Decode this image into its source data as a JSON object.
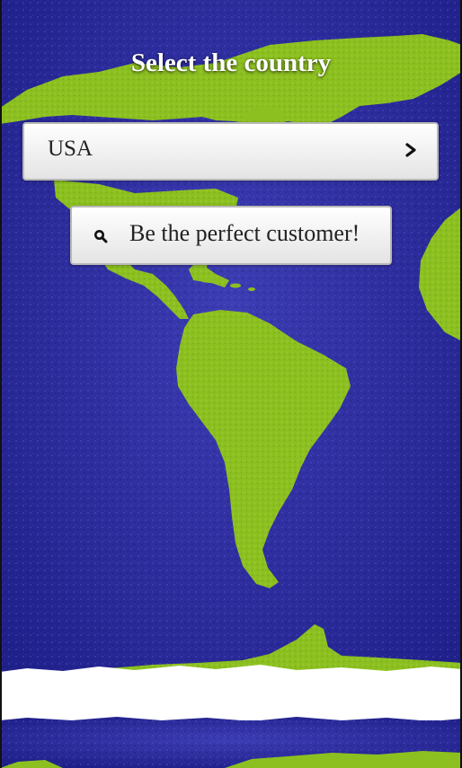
{
  "header": {
    "title": "Select the country"
  },
  "country_select": {
    "value": "USA",
    "icon": "chevron-right-icon"
  },
  "search_button": {
    "label": "Be the perfect customer!",
    "icon": "search-icon"
  },
  "colors": {
    "ocean": "#2a2a9a",
    "land": "#8cc020",
    "button_face": "#eeeeee",
    "title_text": "#ffffff"
  }
}
